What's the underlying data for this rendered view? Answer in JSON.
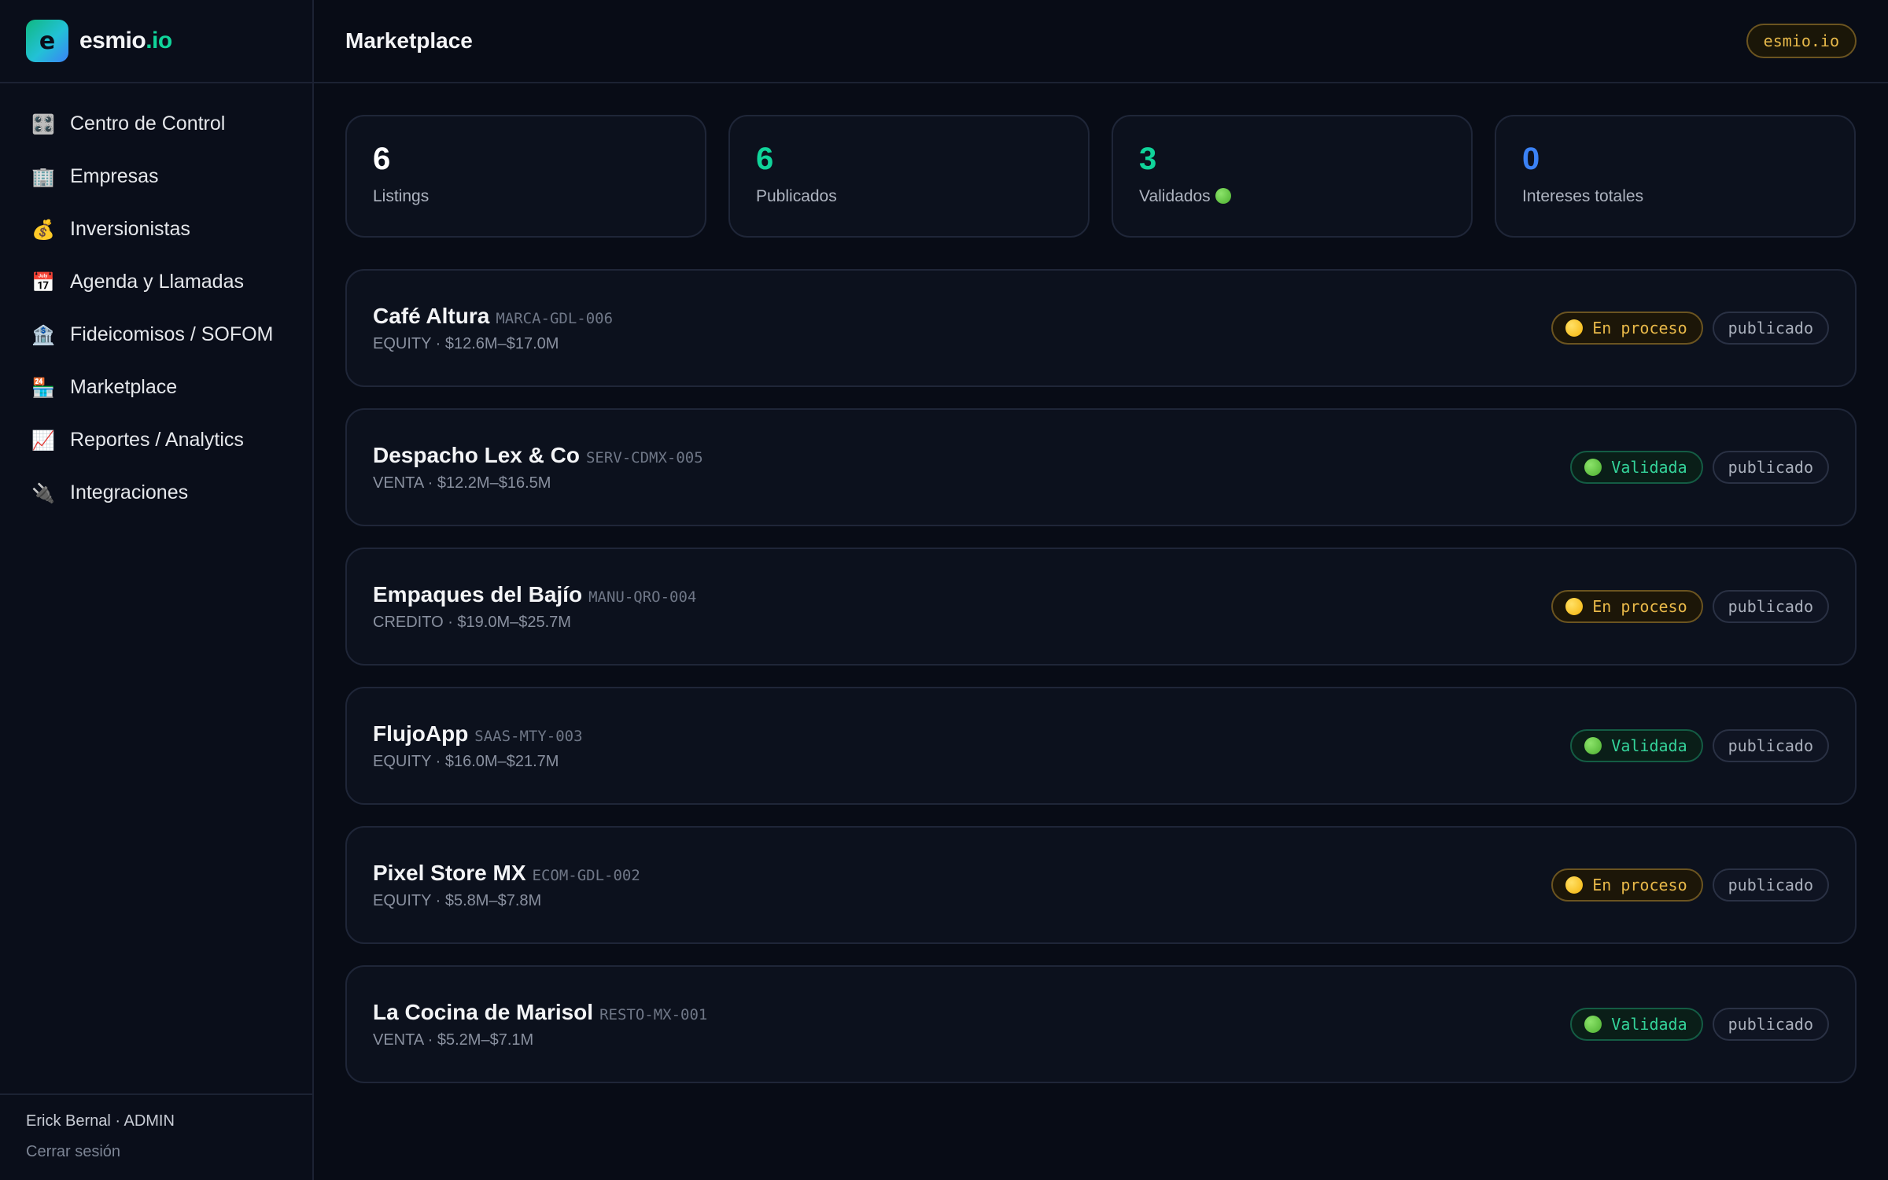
{
  "brand": {
    "logo_letter": "e",
    "name_main": "esmio",
    "name_accent": ".io",
    "accent_color": "#10d49a"
  },
  "sidebar": {
    "items": [
      {
        "icon": "control-knobs-icon",
        "glyph": "🎛️",
        "label": "Centro de Control"
      },
      {
        "icon": "building-icon",
        "glyph": "🏢",
        "label": "Empresas"
      },
      {
        "icon": "money-bag-icon",
        "glyph": "💰",
        "label": "Inversionistas"
      },
      {
        "icon": "calendar-icon",
        "glyph": "📅",
        "label": "Agenda y Llamadas"
      },
      {
        "icon": "bank-icon",
        "glyph": "🏦",
        "label": "Fideicomisos / SOFOM"
      },
      {
        "icon": "store-icon",
        "glyph": "🏪",
        "label": "Marketplace"
      },
      {
        "icon": "chart-increasing-icon",
        "glyph": "📈",
        "label": "Reportes / Analytics"
      },
      {
        "icon": "plug-icon",
        "glyph": "🔌",
        "label": "Integraciones"
      }
    ],
    "user": "Erick Bernal · ADMIN",
    "logout": "Cerrar sesión"
  },
  "header": {
    "title": "Marketplace",
    "badge": "esmio.io"
  },
  "stats": [
    {
      "value": "6",
      "label": "Listings",
      "color": "#ffffff"
    },
    {
      "value": "6",
      "label": "Publicados",
      "color": "#10d49a"
    },
    {
      "value": "3",
      "label": "Validados",
      "color": "#10d49a"
    },
    {
      "value": "0",
      "label": "Intereses totales",
      "color": "#3b82f6"
    }
  ],
  "listings": [
    {
      "name": "Café Altura",
      "code": "MARCA-GDL-006",
      "sub": "EQUITY · $12.6M–$17.0M",
      "status": "En proceso",
      "status_type": "proceso",
      "pub": "publicado"
    },
    {
      "name": "Despacho Lex & Co",
      "code": "SERV-CDMX-005",
      "sub": "VENTA · $12.2M–$16.5M",
      "status": "Validada",
      "status_type": "validada",
      "pub": "publicado"
    },
    {
      "name": "Empaques del Bajío",
      "code": "MANU-QRO-004",
      "sub": "CREDITO · $19.0M–$25.7M",
      "status": "En proceso",
      "status_type": "proceso",
      "pub": "publicado"
    },
    {
      "name": "FlujoApp",
      "code": "SAAS-MTY-003",
      "sub": "EQUITY · $16.0M–$21.7M",
      "status": "Validada",
      "status_type": "validada",
      "pub": "publicado"
    },
    {
      "name": "Pixel Store MX",
      "code": "ECOM-GDL-002",
      "sub": "EQUITY · $5.8M–$7.8M",
      "status": "En proceso",
      "status_type": "proceso",
      "pub": "publicado"
    },
    {
      "name": "La Cocina de Marisol",
      "code": "RESTO-MX-001",
      "sub": "VENTA · $5.2M–$7.1M",
      "status": "Validada",
      "status_type": "validada",
      "pub": "publicado"
    }
  ]
}
